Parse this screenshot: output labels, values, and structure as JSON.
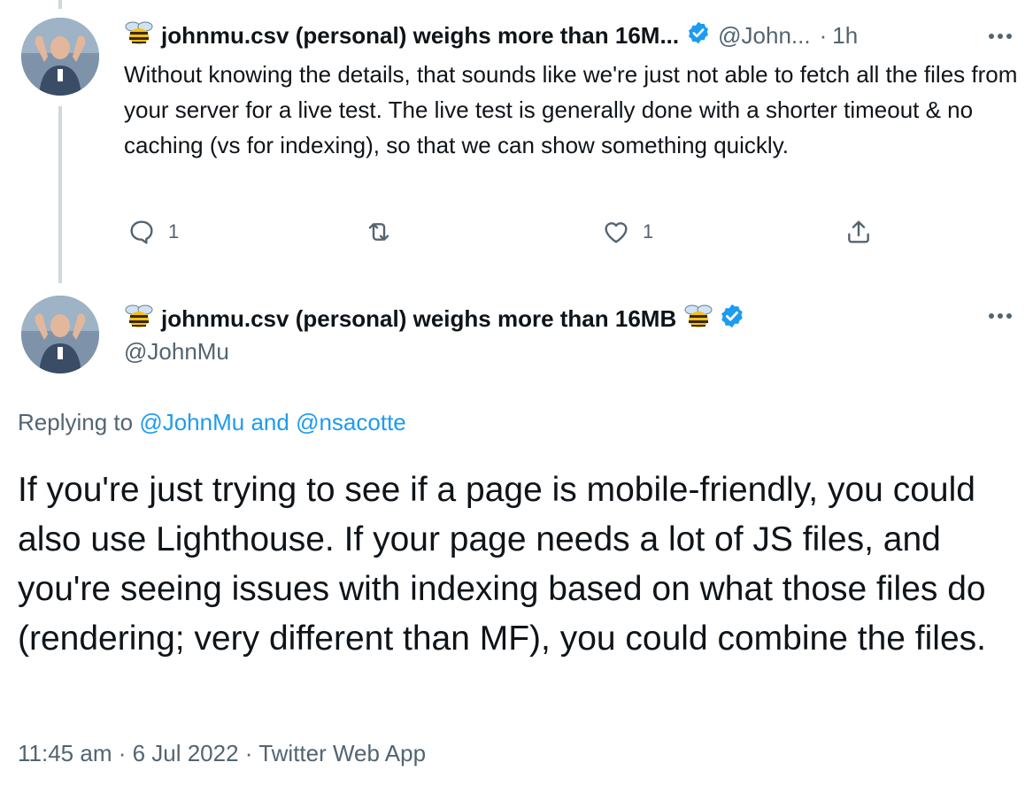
{
  "parent_tweet": {
    "display_name": "johnmu.csv (personal) weighs more than 16M...",
    "handle": "@John...",
    "time_separator": "·",
    "time": "1h",
    "text": "Without knowing the details, that sounds like we're just not able to fetch all the files from your server for a live test. The live test is generally done with a shorter timeout & no caching (vs for indexing), so that we can show something quickly.",
    "actions": {
      "reply_count": "1",
      "retweet_count": "",
      "like_count": "1"
    }
  },
  "main_tweet": {
    "display_name": "johnmu.csv (personal) weighs more than 16MB",
    "handle": "@JohnMu",
    "replying_prefix": "Replying to",
    "replying_user1": "@JohnMu",
    "replying_and": "and",
    "replying_user2": "@nsacotte",
    "text": "If you're just trying to see if a page is mobile-friendly, you could also use Lighthouse. If your page needs a lot of JS files, and you're seeing issues with indexing based on what those files do (rendering; very different than MF), you could combine the files.",
    "timestamp": "11:45 am · 6 Jul 2022 · Twitter Web App"
  },
  "colors": {
    "accent": "#1d9bf0",
    "secondary_text": "#536471",
    "primary_text": "#0f1419",
    "thread_line": "#cfd9de"
  },
  "icons": {
    "bee": "bee-emoji-icon",
    "verified": "verified-badge-icon",
    "reply": "reply-icon",
    "retweet": "retweet-icon",
    "like": "heart-icon",
    "share": "share-icon",
    "more": "more-options-icon"
  }
}
